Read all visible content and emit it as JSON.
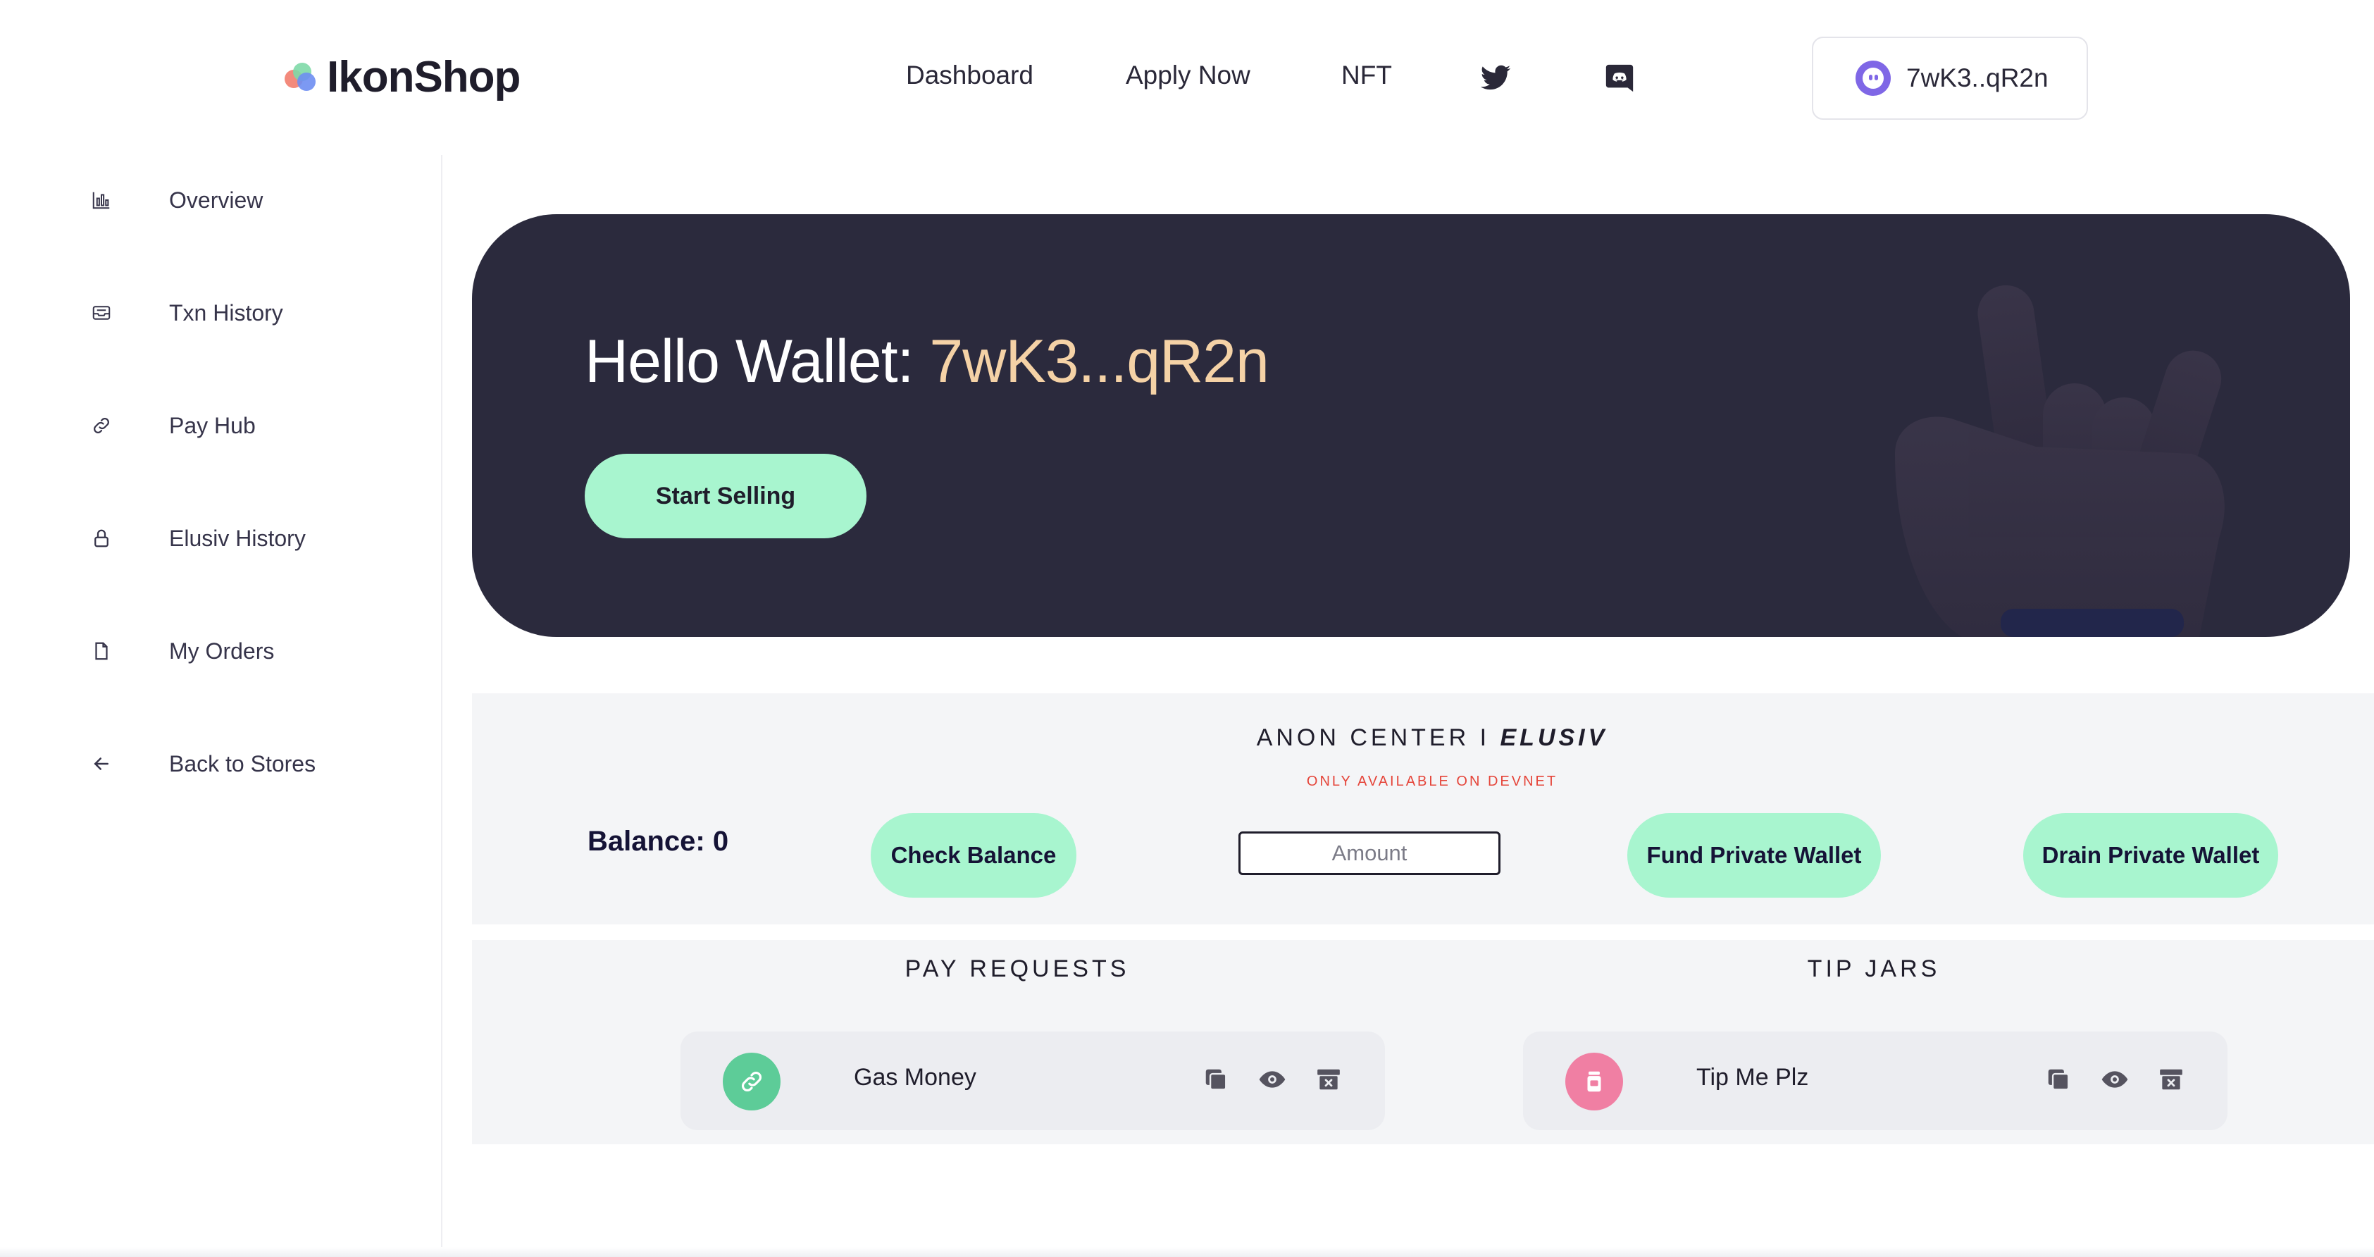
{
  "header": {
    "logo_text": "IkonShop",
    "nav": {
      "dashboard": "Dashboard",
      "apply_now": "Apply Now",
      "nft": "NFT"
    },
    "wallet_label": "7wK3..qR2n"
  },
  "sidebar": {
    "items": [
      {
        "label": "Overview",
        "icon": "bar-chart-icon"
      },
      {
        "label": "Txn History",
        "icon": "inbox-icon"
      },
      {
        "label": "Pay Hub",
        "icon": "link-icon"
      },
      {
        "label": "Elusiv History",
        "icon": "lock-icon"
      },
      {
        "label": "My Orders",
        "icon": "file-icon"
      },
      {
        "label": "Back to Stores",
        "icon": "arrow-left-icon"
      }
    ]
  },
  "hero": {
    "greeting": "Hello Wallet: ",
    "address": "7wK3...qR2n",
    "start_selling": "Start Selling"
  },
  "anon": {
    "title_prefix": "ANON CENTER I ",
    "title_brand": "ELUSIV",
    "subtitle": "ONLY AVAILABLE ON DEVNET",
    "balance": "Balance: 0",
    "check_balance": "Check Balance",
    "amount_placeholder": "Amount",
    "fund": "Fund Private Wallet",
    "drain": "Drain Private Wallet"
  },
  "pay_requests": {
    "title": "PAY REQUESTS",
    "items": [
      {
        "name": "Gas Money"
      }
    ]
  },
  "tip_jars": {
    "title": "TIP JARS",
    "items": [
      {
        "name": "Tip Me Plz"
      }
    ]
  },
  "colors": {
    "accent_green": "#a8f5cf",
    "hero_bg": "#2b2a3d",
    "address_color": "#f5d2a6",
    "devnet_red": "#e5453a"
  }
}
